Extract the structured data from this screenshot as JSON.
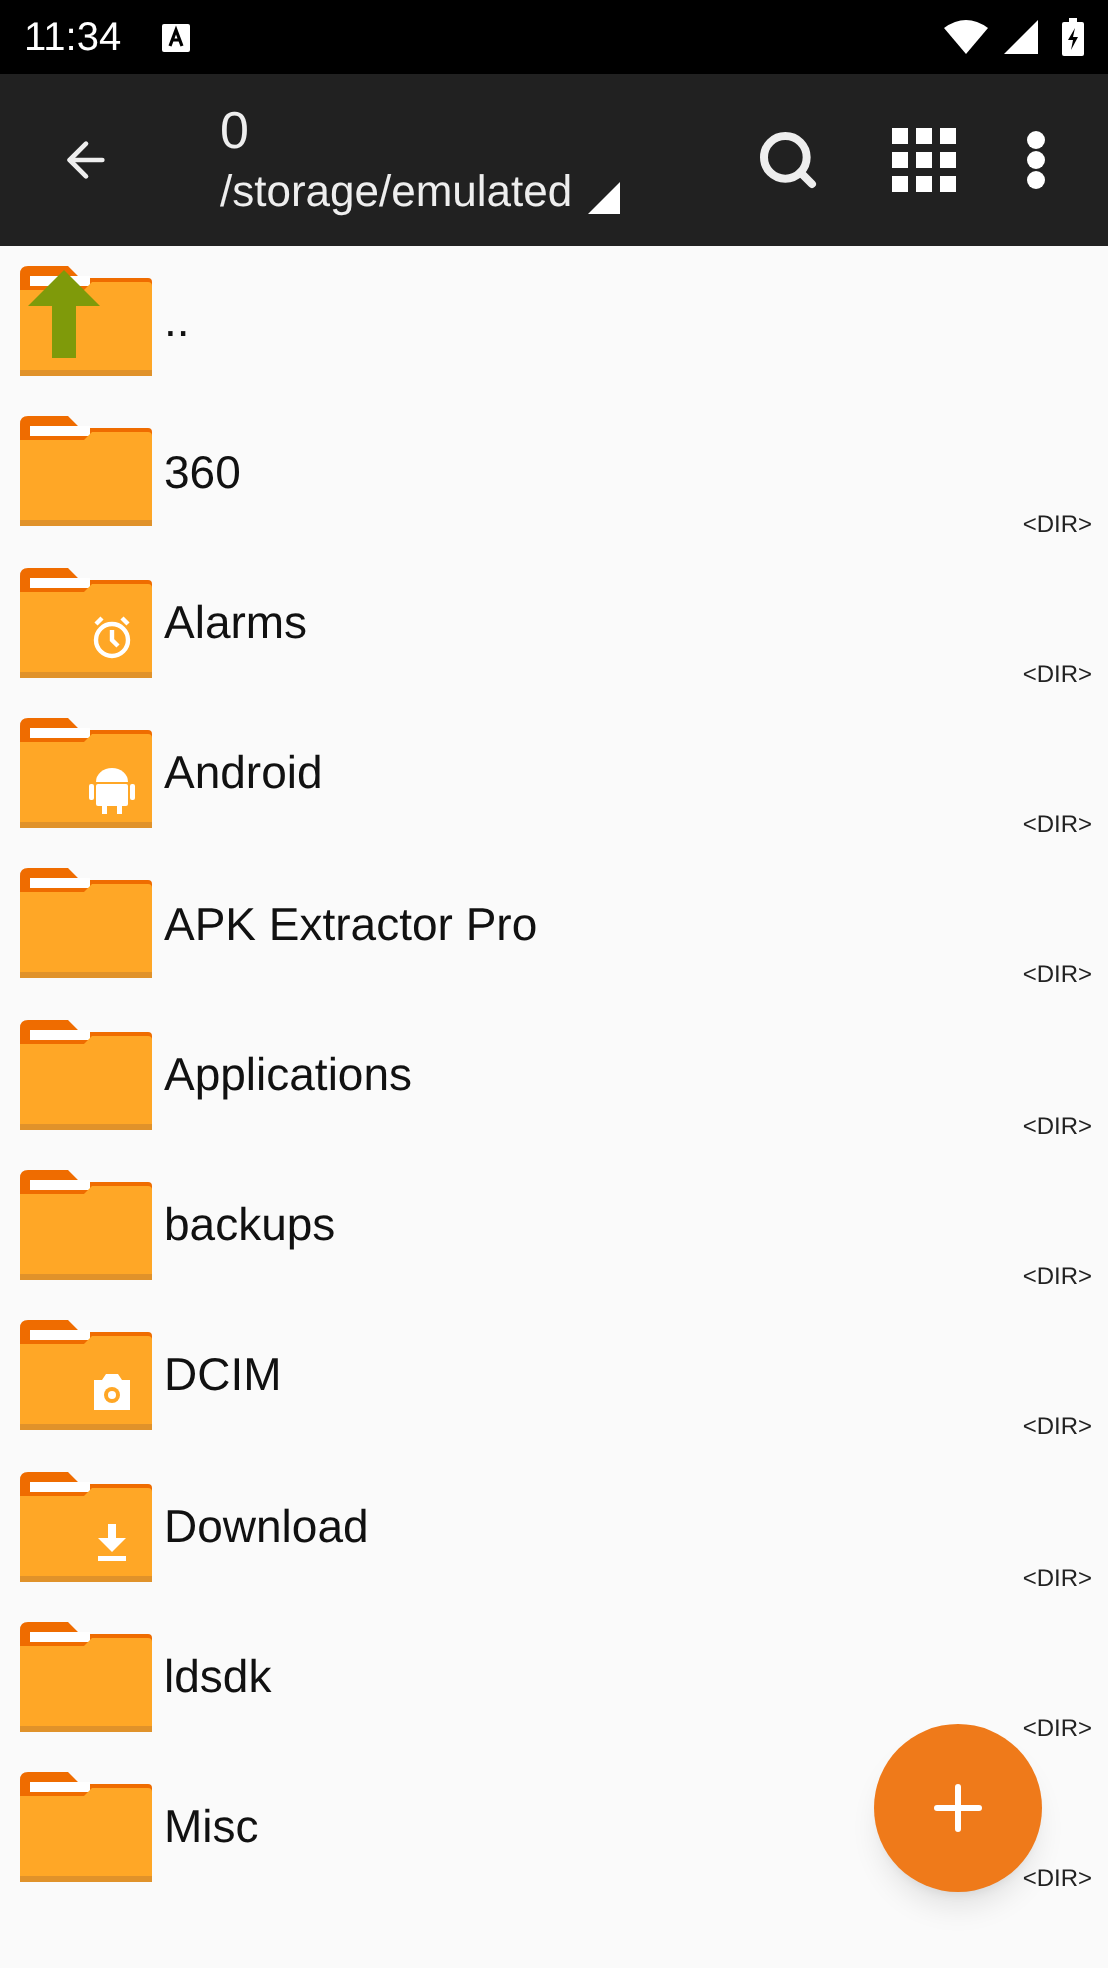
{
  "status_bar": {
    "time": "11:34"
  },
  "toolbar": {
    "title": "0",
    "path": "/storage/emulated"
  },
  "files": [
    {
      "name": "..",
      "kind": "up"
    },
    {
      "name": "360",
      "kind": "plain",
      "type": "<DIR>"
    },
    {
      "name": "Alarms",
      "kind": "alarm",
      "type": "<DIR>"
    },
    {
      "name": "Android",
      "kind": "android",
      "type": "<DIR>"
    },
    {
      "name": "APK Extractor Pro",
      "kind": "plain",
      "type": "<DIR>"
    },
    {
      "name": "Applications",
      "kind": "plain",
      "type": "<DIR>"
    },
    {
      "name": "backups",
      "kind": "plain",
      "type": "<DIR>"
    },
    {
      "name": "DCIM",
      "kind": "camera",
      "type": "<DIR>"
    },
    {
      "name": "Download",
      "kind": "download",
      "type": "<DIR>"
    },
    {
      "name": "ldsdk",
      "kind": "plain",
      "type": "<DIR>"
    },
    {
      "name": "Misc",
      "kind": "plain",
      "type": "<DIR>"
    }
  ]
}
